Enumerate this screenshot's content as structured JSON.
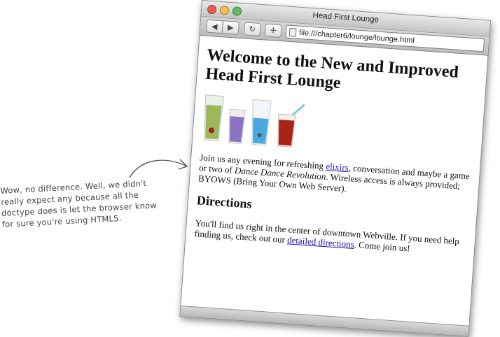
{
  "annotation": {
    "lines": [
      "Wow, no difference. Well, we didn't",
      "really expect any because all the",
      "doctype does is let the browser know",
      "for sure you're using HTML5."
    ]
  },
  "window": {
    "title": "Head First Lounge",
    "url": "file:///chapter6/lounge/lounge.html"
  },
  "toolbar": {
    "back_icon": "back-arrow-icon",
    "forward_icon": "forward-arrow-icon",
    "reload_icon": "reload-icon",
    "add_icon": "plus-icon"
  },
  "page": {
    "heading": "Welcome to the New and Improved Head First Lounge",
    "intro": {
      "before_link": "Join us any evening for refreshing ",
      "link": "elixirs",
      "after_link": ", conversation and maybe a game or two of ",
      "italic": "Dance Dance Revolution",
      "rest": ". Wireless access is always provided; BYOWS (Bring Your Own Web Server)."
    },
    "directions_heading": "Directions",
    "directions": {
      "before_link": "You'll find us right in the center of downtown Webville. If you need help finding us, check out our ",
      "link": "detailed directions",
      "after_link": ". Come join us!"
    }
  },
  "colors": {
    "close": "#ee5a52",
    "minimize": "#f4bf4f",
    "zoom": "#5cc05a",
    "link": "#1a0dab"
  }
}
